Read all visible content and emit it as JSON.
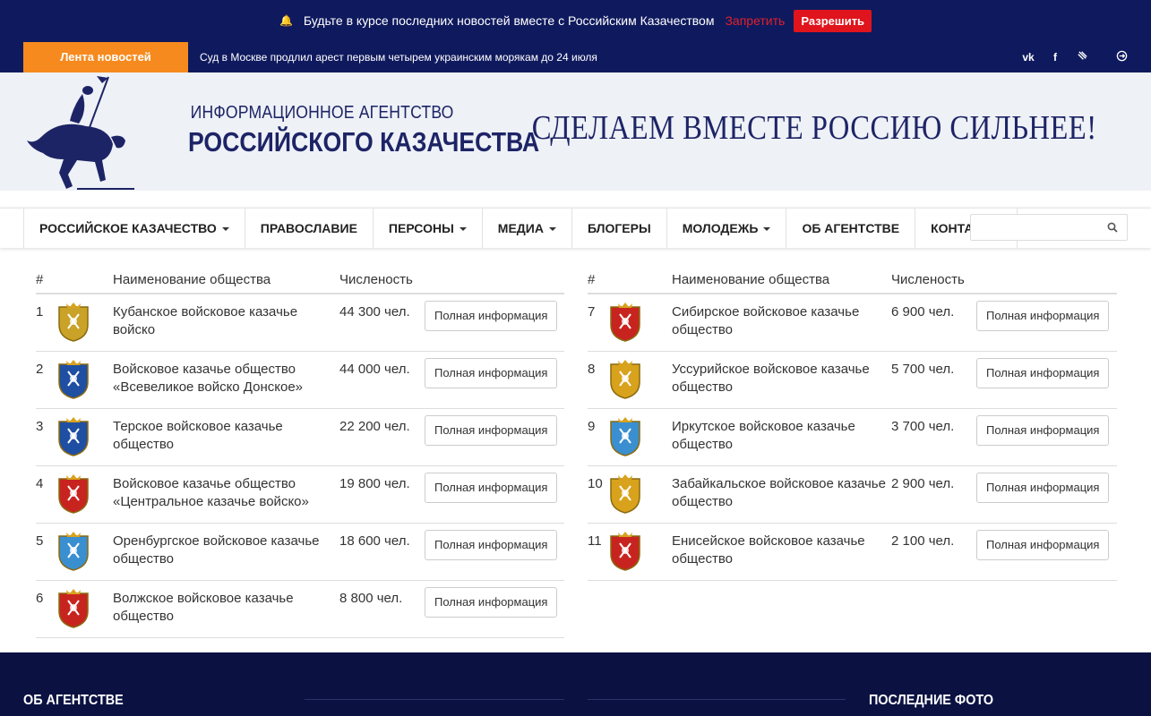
{
  "notification": {
    "text": "Будьте в курсе последних новостей вместе с Российским Казачеством",
    "deny_label": "Запретить",
    "allow_label": "Разрешить"
  },
  "news": {
    "label": "Лента новостей",
    "ticker": "Суд в Москве продлил арест первым четырем украинским морякам до 24 июля"
  },
  "social": {
    "vk": "vk",
    "facebook": "f"
  },
  "header": {
    "subtitle": "ИНФОРМАЦИОННОЕ АГЕНТСТВО",
    "title": "РОССИЙСКОГО КАЗАЧЕСТВА",
    "slogan": "СДЕЛАЕМ ВМЕСТЕ РОССИЮ СИЛЬНЕЕ!"
  },
  "nav": {
    "items": [
      {
        "label": "РОССИЙСКОЕ КАЗАЧЕСТВО"
      },
      {
        "label": "ПРАВОСЛАВИЕ"
      },
      {
        "label": "ПЕРСОНЫ"
      },
      {
        "label": "МЕДИА"
      },
      {
        "label": "БЛОГЕРЫ"
      },
      {
        "label": "МОЛОДЕЖЬ"
      },
      {
        "label": "ОБ АГЕНТСТВЕ"
      },
      {
        "label": "КОНТАКТЫ"
      }
    ],
    "search_placeholder": ""
  },
  "table": {
    "col_num": "#",
    "col_name": "Наименование общества",
    "col_count": "Численость",
    "button_label": "Полная информация",
    "rows": [
      {
        "num": "1",
        "name": "Кубанское войсковое казачье войско",
        "count": "44 300 чел.",
        "color": "#c9a227"
      },
      {
        "num": "2",
        "name": "Войсковое казачье общество «Всевеликое войско Донское»",
        "count": "44 000 чел.",
        "color": "#1f4fa3"
      },
      {
        "num": "3",
        "name": "Терское войсковое казачье общество",
        "count": "22 200 чел.",
        "color": "#1f4fa3"
      },
      {
        "num": "4",
        "name": "Войсковое казачье общество «Центральное казачье войско»",
        "count": "19 800 чел.",
        "color": "#c8241f"
      },
      {
        "num": "5",
        "name": "Оренбургское войсковое казачье общество",
        "count": "18 600 чел.",
        "color": "#3a8fd0"
      },
      {
        "num": "6",
        "name": "Волжское войсковое казачье общество",
        "count": "8 800 чел.",
        "color": "#c8241f"
      },
      {
        "num": "7",
        "name": "Сибирское войсковое казачье общество",
        "count": "6 900 чел.",
        "color": "#c8241f"
      },
      {
        "num": "8",
        "name": "Уссурийское войсковое казачье общество",
        "count": "5 700 чел.",
        "color": "#d9a21c"
      },
      {
        "num": "9",
        "name": "Иркутское войсковое казачье общество",
        "count": "3 700 чел.",
        "color": "#3a8fd0"
      },
      {
        "num": "10",
        "name": "Забайкальское войсковое казачье общество",
        "count": "2 900 чел.",
        "color": "#d9a21c"
      },
      {
        "num": "11",
        "name": "Енисейское войсковое казачье общество",
        "count": "2 100 чел.",
        "color": "#c8241f"
      }
    ]
  },
  "footer": {
    "about_title": "ОБ АГЕНТСТВЕ",
    "photos_title": "ПОСЛЕДНИЕ ФОТО"
  }
}
